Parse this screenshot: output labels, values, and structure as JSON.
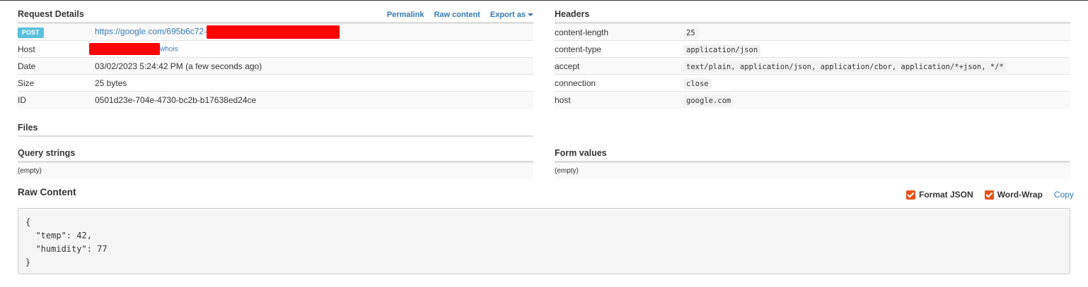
{
  "request_details": {
    "title": "Request Details",
    "links": {
      "permalink": "Permalink",
      "raw_content": "Raw content",
      "export_as": "Export as"
    },
    "method": "POST",
    "url": "https://google.com/695b6c72-",
    "rows": [
      {
        "key": "Host",
        "value": "",
        "link": "whois"
      },
      {
        "key": "Date",
        "value": "03/02/2023 5:24:42 PM (a few seconds ago)"
      },
      {
        "key": "Size",
        "value": "25 bytes"
      },
      {
        "key": "ID",
        "value": "0501d23e-704e-4730-bc2b-b17638ed24ce"
      }
    ]
  },
  "files": {
    "title": "Files"
  },
  "query_strings": {
    "title": "Query strings",
    "value": "(empty)"
  },
  "headers": {
    "title": "Headers",
    "rows": [
      {
        "key": "content-length",
        "value": "25"
      },
      {
        "key": "content-type",
        "value": "application/json"
      },
      {
        "key": "accept",
        "value": "text/plain, application/json, application/cbor, application/*+json, */*"
      },
      {
        "key": "connection",
        "value": "close"
      },
      {
        "key": "host",
        "value": "google.com"
      }
    ]
  },
  "form_values": {
    "title": "Form values",
    "value": "(empty)"
  },
  "raw_content": {
    "title": "Raw Content",
    "format_json": "Format JSON",
    "word_wrap": "Word-Wrap",
    "copy": "Copy",
    "body": "{\n  \"temp\": 42,\n  \"humidity\": 77\n}"
  },
  "colors": {
    "link": "#337ab7",
    "badge": "#5bc0de",
    "checkbox": "#e5531a",
    "redaction": "#ff0000"
  }
}
